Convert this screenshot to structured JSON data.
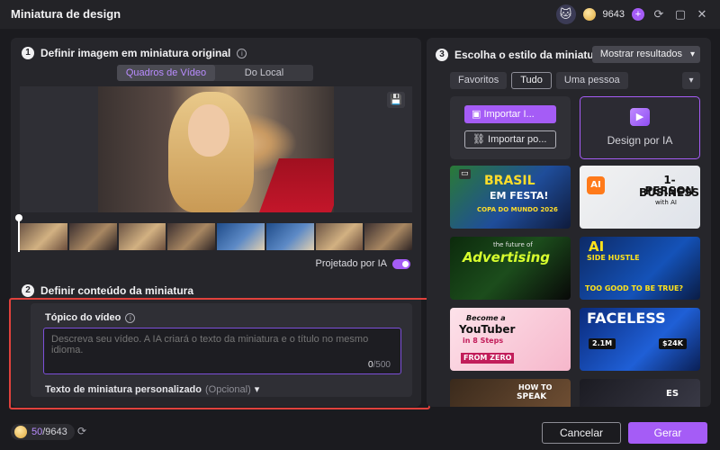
{
  "window": {
    "title": "Miniatura de design",
    "credits": "9643"
  },
  "section1": {
    "number": "1",
    "title": "Definir imagem em miniatura original",
    "tabs": [
      "Quadros de Vídeo",
      "Do Local"
    ],
    "ai_projected_label": "Projetado por IA",
    "ai_projected_on": true
  },
  "section2": {
    "number": "2",
    "title": "Definir conteúdo da miniatura",
    "topic_label": "Tópico do vídeo",
    "topic_placeholder": "Descreva seu vídeo. A IA criará o texto da miniatura e o título no mesmo idioma.",
    "counter_current": "0",
    "counter_max": "/500",
    "custom_text_label": "Texto de miniatura personalizado",
    "custom_text_optional": "(Opcional)"
  },
  "section3": {
    "number": "3",
    "title": "Escolha o estilo da miniatura",
    "show_results": "Mostrar resultados",
    "filters": [
      "Favoritos",
      "Tudo",
      "Uma pessoa"
    ],
    "import_image": "Importar I...",
    "import_post": "Importar po...",
    "ai_design": "Design por IA",
    "templates": [
      {
        "line1": "BRASIL",
        "line2": "EM FESTA!",
        "line3": "COPA DO MUNDO 2026"
      },
      {
        "line1": "1-PERSON",
        "line2": "BUSINESS",
        "line3": "with AI"
      },
      {
        "line1": "the future of",
        "line2": "Advertising"
      },
      {
        "line1": "AI",
        "line2": "SIDE HUSTLE",
        "line3": "TOO GOOD TO BE TRUE?"
      },
      {
        "line1": "Become a",
        "line2": "YouTuber",
        "line3": "in 8 Steps",
        "line4": "FROM ZERO"
      },
      {
        "line1": "FACELESS",
        "line2": "2.1M",
        "line3": "$24K"
      },
      {
        "line1": "HOW TO",
        "line2": "SPEAK"
      },
      {
        "line1": "ES"
      }
    ]
  },
  "footer": {
    "credits_used": "50",
    "credits_total": "/9643",
    "cancel": "Cancelar",
    "generate": "Gerar"
  }
}
